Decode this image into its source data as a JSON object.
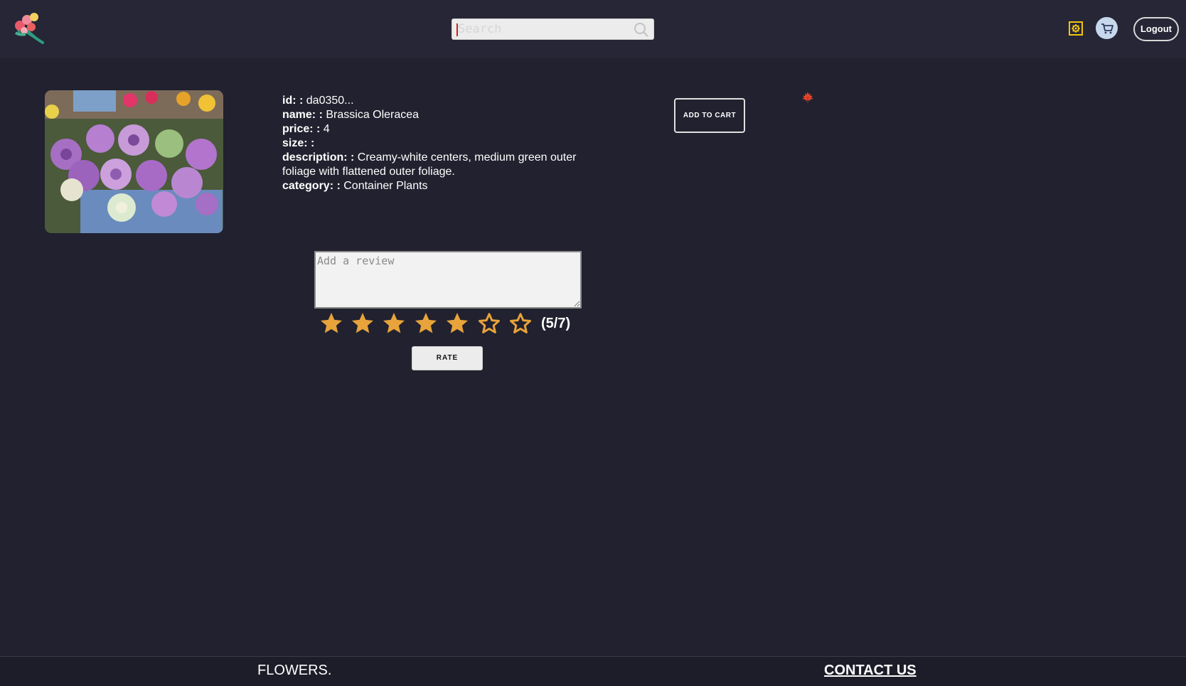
{
  "header": {
    "search": {
      "value": "",
      "placeholder": "Search"
    },
    "logout_label": "Logout"
  },
  "product": {
    "fields": [
      {
        "label": "id: :",
        "value": "da0350..."
      },
      {
        "label": "name: :",
        "value": "Brassica Oleracea"
      },
      {
        "label": "price: :",
        "value": "4"
      },
      {
        "label": "size: :",
        "value": ""
      },
      {
        "label": "description: :",
        "value": "Creamy-white centers, medium green outer foliage with flattened outer foliage."
      },
      {
        "label": "category: :",
        "value": "Container Plants"
      }
    ],
    "add_to_cart_label": "ADD TO CART"
  },
  "review": {
    "placeholder": "Add a review",
    "value": "",
    "rating": 5,
    "max_rating": 7,
    "rating_text": "(5/7)",
    "rate_label": "RATE"
  },
  "footer": {
    "brand": "FLOWERS.",
    "contact_label": "CONTACT US"
  },
  "colors": {
    "background": "#21212f",
    "header": "#262636",
    "star": "#e8a33a",
    "accent_yellow": "#f2c40f"
  },
  "icons": {
    "logo": "flower-bouquet-logo",
    "search": "magnifier-icon",
    "settings": "gear-icon",
    "cart": "cart-icon",
    "leaf": "maple-leaf-icon",
    "star_filled": "star-filled-icon",
    "star_empty": "star-outline-icon"
  }
}
